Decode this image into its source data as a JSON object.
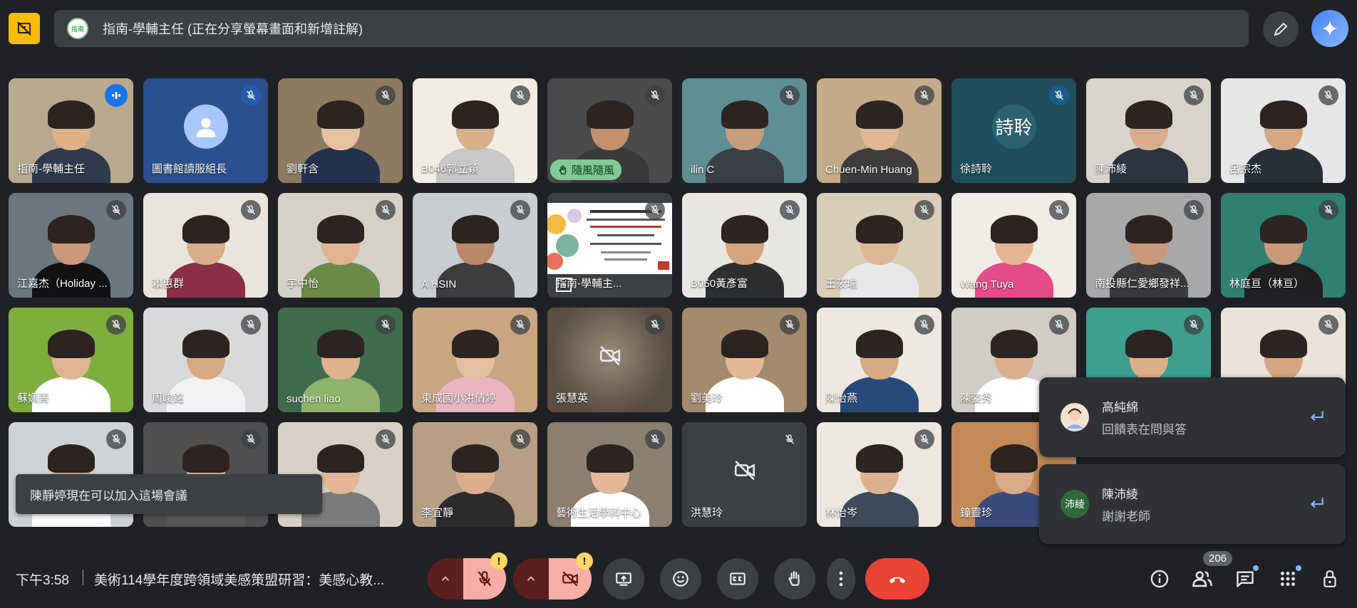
{
  "top_bar": {
    "presenter_label": "指南-學輔主任 (正在分享螢幕畫面和新增註解)",
    "presenter_avatar_text": "指南"
  },
  "tiles": [
    {
      "name": "指南-學輔主任",
      "row": 0,
      "col": 0,
      "state": "speaking",
      "bg": "#b8a890",
      "skin": "#e0b089",
      "shirt": "#2f3b4c"
    },
    {
      "name": "圖書館讀服組長",
      "row": 0,
      "col": 1,
      "state": "avatar",
      "bg": "#2c4f8f"
    },
    {
      "name": "劉軒含",
      "row": 0,
      "col": 2,
      "state": "video",
      "bg": "#8d7a63",
      "skin": "#e8c2a0",
      "shirt": "#23324f"
    },
    {
      "name": "B046郭立穎",
      "row": 0,
      "col": 3,
      "state": "video",
      "bg": "#f2ede4",
      "skin": "#d9b08c",
      "shirt": "#c8c8c8"
    },
    {
      "name": "",
      "row": 0,
      "col": 4,
      "state": "reaction",
      "bg": "#4a4a4a",
      "skin": "#c4916e",
      "shirt": "#3a3a3a",
      "reaction": "隨風隨風"
    },
    {
      "name": "ilin C",
      "row": 0,
      "col": 5,
      "state": "video",
      "bg": "#5f8f95",
      "skin": "#c99c7a",
      "shirt": "#3a3f45"
    },
    {
      "name": "Chuen-Min Huang",
      "row": 0,
      "col": 6,
      "state": "video",
      "bg": "#c3ab8a",
      "skin": "#e2b795",
      "shirt": "#3e3c3a"
    },
    {
      "name": "徐詩聆",
      "row": 0,
      "col": 7,
      "state": "initials",
      "bg": "#1f4e5a",
      "initials": "詩聆"
    },
    {
      "name": "陳沛綾",
      "row": 0,
      "col": 8,
      "state": "video",
      "bg": "#d8d3cc",
      "skin": "#d9ad8b",
      "shirt": "#2d3340"
    },
    {
      "name": "呂宗杰",
      "row": 0,
      "col": 9,
      "state": "video",
      "bg": "#e6e6e6",
      "skin": "#d6a783",
      "shirt": "#27303a"
    },
    {
      "name": "江嘉杰（Holiday ...",
      "row": 1,
      "col": 0,
      "state": "video",
      "bg": "#6c7680",
      "skin": "#c9987a",
      "shirt": "#111111"
    },
    {
      "name": "賴惠群",
      "row": 1,
      "col": 1,
      "state": "video",
      "bg": "#e9e4de",
      "skin": "#d9ae8c",
      "shirt": "#8b2e4a"
    },
    {
      "name": "宇中怡",
      "row": 1,
      "col": 2,
      "state": "video",
      "bg": "#d6d1c7",
      "skin": "#e0b493",
      "shirt": "#6b8a4a"
    },
    {
      "name": "A HSIN",
      "row": 1,
      "col": 3,
      "state": "video",
      "bg": "#c9cdd1",
      "skin": "#b8876a",
      "shirt": "#3d3d3d"
    },
    {
      "name": "指南-學輔主...",
      "row": 1,
      "col": 4,
      "state": "slide",
      "bg": "#3c4043"
    },
    {
      "name": "B050黃彥富",
      "row": 1,
      "col": 5,
      "state": "video",
      "bg": "#e8e6e2",
      "skin": "#d5a57f",
      "shirt": "#2e2e2e"
    },
    {
      "name": "王筱瑜",
      "row": 1,
      "col": 6,
      "state": "video",
      "bg": "#d9cdb8",
      "skin": "#dcb496",
      "shirt": "#e8e8e8"
    },
    {
      "name": "Wang Tuya",
      "row": 1,
      "col": 7,
      "state": "video",
      "bg": "#f0ece6",
      "skin": "#e3b796",
      "shirt": "#e54b86"
    },
    {
      "name": "南投縣仁愛鄉發祥...",
      "row": 1,
      "col": 8,
      "state": "video",
      "bg": "#a8a8a8",
      "skin": "#c8987a",
      "shirt": "#3a3a3a"
    },
    {
      "name": "林庭亘（林亘）",
      "row": 1,
      "col": 9,
      "state": "video",
      "bg": "#2f7f73",
      "skin": "#c9997b",
      "shirt": "#1f1f1f"
    },
    {
      "name": "蘇姵菁",
      "row": 2,
      "col": 0,
      "state": "video",
      "bg": "#7fae3f",
      "skin": "#e0b493",
      "shirt": "#ffffff"
    },
    {
      "name": "周峻銘",
      "row": 2,
      "col": 1,
      "state": "video",
      "bg": "#d9d9d9",
      "skin": "#d8a985",
      "shirt": "#f2f2f2"
    },
    {
      "name": "suchen liao",
      "row": 2,
      "col": 2,
      "state": "video",
      "bg": "#3f6b4d",
      "skin": "#dfb290",
      "shirt": "#8fb36a"
    },
    {
      "name": "東成國小洪倩婷",
      "row": 2,
      "col": 3,
      "state": "video",
      "bg": "#c9a582",
      "skin": "#e6bea0",
      "shirt": "#e8b5c0"
    },
    {
      "name": "張慧英",
      "row": 2,
      "col": 4,
      "state": "camoff",
      "bg": "#7a6a5a"
    },
    {
      "name": "劉美玲",
      "row": 2,
      "col": 5,
      "state": "video",
      "bg": "#a38b6d",
      "skin": "#e3b898",
      "shirt": "#ffffff"
    },
    {
      "name": "陳怡燕",
      "row": 2,
      "col": 6,
      "state": "video",
      "bg": "#ede8e1",
      "skin": "#d8a987",
      "shirt": "#274a7a"
    },
    {
      "name": "陳姿秀",
      "row": 2,
      "col": 7,
      "state": "video",
      "bg": "#d1ccc5",
      "skin": "#dcb08e",
      "shirt": "#ffffff"
    },
    {
      "name": "",
      "row": 2,
      "col": 8,
      "state": "video",
      "bg": "#3f9f8f",
      "skin": "#dcae8b",
      "shirt": "#ffffff"
    },
    {
      "name": "",
      "row": 2,
      "col": 9,
      "state": "video",
      "bg": "#e9e3da",
      "skin": "#d6a683",
      "shirt": "#333333"
    },
    {
      "name": "",
      "row": 3,
      "col": 0,
      "state": "video",
      "bg": "#cfd3d6",
      "skin": "#d8a985",
      "shirt": "#ffffff"
    },
    {
      "name": "",
      "row": 3,
      "col": 1,
      "state": "video",
      "bg": "#4f4f4f",
      "skin": "#e0b493",
      "shirt": "#555555"
    },
    {
      "name": "",
      "row": 3,
      "col": 2,
      "state": "video",
      "bg": "#d7d0c6",
      "skin": "#e2b696",
      "shirt": "#7a7a7a"
    },
    {
      "name": "李宜靜",
      "row": 3,
      "col": 3,
      "state": "video",
      "bg": "#b79f86",
      "skin": "#dcae8c",
      "shirt": "#2b2b2b"
    },
    {
      "name": "藝術生活學科中心",
      "row": 3,
      "col": 4,
      "state": "video",
      "bg": "#8d7f70",
      "skin": "#e3b898",
      "shirt": "#ffffff"
    },
    {
      "name": "洪慧玲",
      "row": 3,
      "col": 5,
      "state": "camoff_dark",
      "bg": "#3c4043"
    },
    {
      "name": "林怡岑",
      "row": 3,
      "col": 6,
      "state": "video",
      "bg": "#ece7e1",
      "skin": "#ddb190",
      "shirt": "#3d4a5a"
    },
    {
      "name": "鐘靈珍",
      "row": 3,
      "col": 7,
      "state": "video",
      "bg": "#c48a5a",
      "skin": "#d9ab88",
      "shirt": "#3a4b7a"
    }
  ],
  "toast": {
    "text": "陳靜婷現在可以加入這場會議"
  },
  "chat_notifications": [
    {
      "name": "高純綿",
      "message": "回饋表在問與答",
      "avatar_text": "",
      "avatar_color": "#f1e3d3"
    },
    {
      "name": "陳沛綾",
      "message": "謝謝老師",
      "avatar_text": "沛綾",
      "avatar_color": "#2e6b3a"
    }
  ],
  "bottom_bar": {
    "time": "下午3:58",
    "meeting_title": "美術114學年度跨領域美感策盟研習：美感心教...",
    "participant_count": "206",
    "warn_symbol": "!"
  },
  "colors": {
    "end_call": "#ea4335",
    "mic_off": "#f6aea9",
    "annotation_button": "#fbbc04",
    "accent_blue": "#8ab4f8"
  }
}
